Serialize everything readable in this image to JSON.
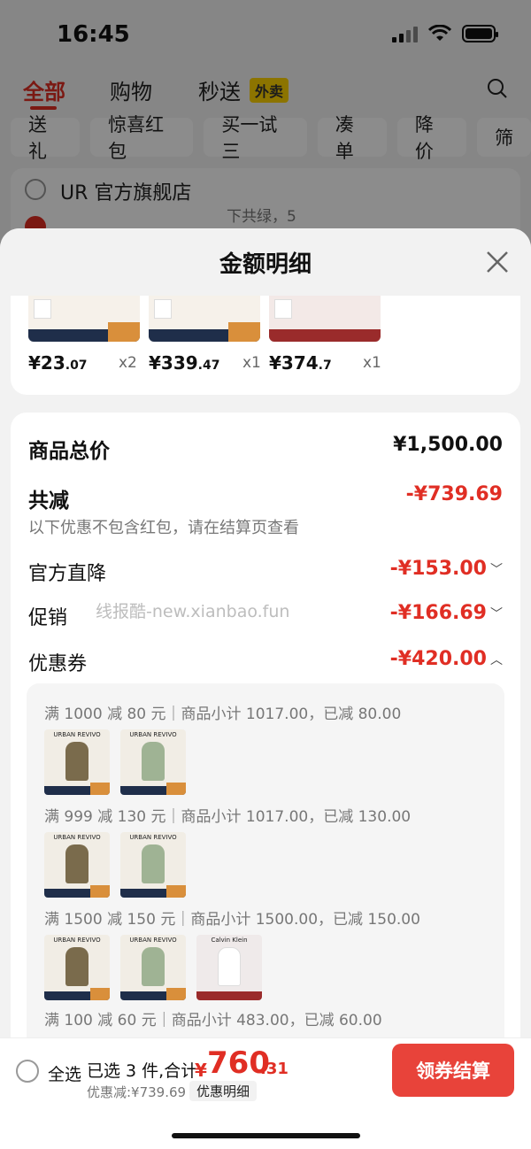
{
  "status_bar": {
    "time": "16:45"
  },
  "background": {
    "tabs": [
      {
        "label": "全部",
        "active": true
      },
      {
        "label": "购物",
        "active": false
      },
      {
        "label": "秒送",
        "active": false
      }
    ],
    "badge": "外卖",
    "chips": [
      "送礼",
      "惊喜红包",
      "买一试三",
      "凑单",
      "降价",
      "筛"
    ],
    "store_name": "UR 官方旗舰店",
    "store_misc": "下共绿，5"
  },
  "sheet": {
    "title": "金额明细",
    "products": [
      {
        "price_int": "¥23",
        "price_dec": ".07",
        "qty": "x2"
      },
      {
        "price_int": "¥339",
        "price_dec": ".47",
        "qty": "x1"
      },
      {
        "price_int": "¥374",
        "price_dec": ".7",
        "qty": "x1"
      }
    ],
    "summary": {
      "total_label": "商品总价",
      "total_value": "¥1,500.00",
      "reduce_label": "共减",
      "reduce_value": "-¥739.69",
      "reduce_note": "以下优惠不包含红包，请在结算页查看",
      "official_label": "官方直降",
      "official_value": "-¥153.00",
      "promo_label": "促销",
      "promo_value": "-¥166.69",
      "coupon_label": "优惠券",
      "coupon_value": "-¥420.00",
      "watermark": "线报酷-new.xianbao.fun"
    },
    "coupon_lines": [
      "满 1000 减 80 元｜商品小计 1017.00，已减 80.00",
      "满 999 减 130 元｜商品小计 1017.00，已减 130.00",
      "满 1500 减 150 元｜商品小计 1500.00，已减 150.00",
      "满 100 减 60 元｜商品小计 483.00，已减 60.00"
    ],
    "brand_text": "URBAN REVIVO",
    "brand_text_ck": "Calvin Klein"
  },
  "bottom_bar": {
    "select_all": "全选",
    "selected": "已选 3 件,合计:",
    "currency": "¥",
    "total_int": "760",
    "total_dec": ".31",
    "discount": "优惠减:¥739.69",
    "detail_tag": "优惠明细",
    "checkout": "领券结算"
  },
  "colors": {
    "accent": "#e02e24",
    "checkout_button": "#e8433a"
  },
  "icons": [
    "close-icon",
    "search-icon",
    "chevron-down-icon",
    "chevron-up-icon",
    "signal-icon",
    "wifi-icon",
    "battery-icon"
  ]
}
